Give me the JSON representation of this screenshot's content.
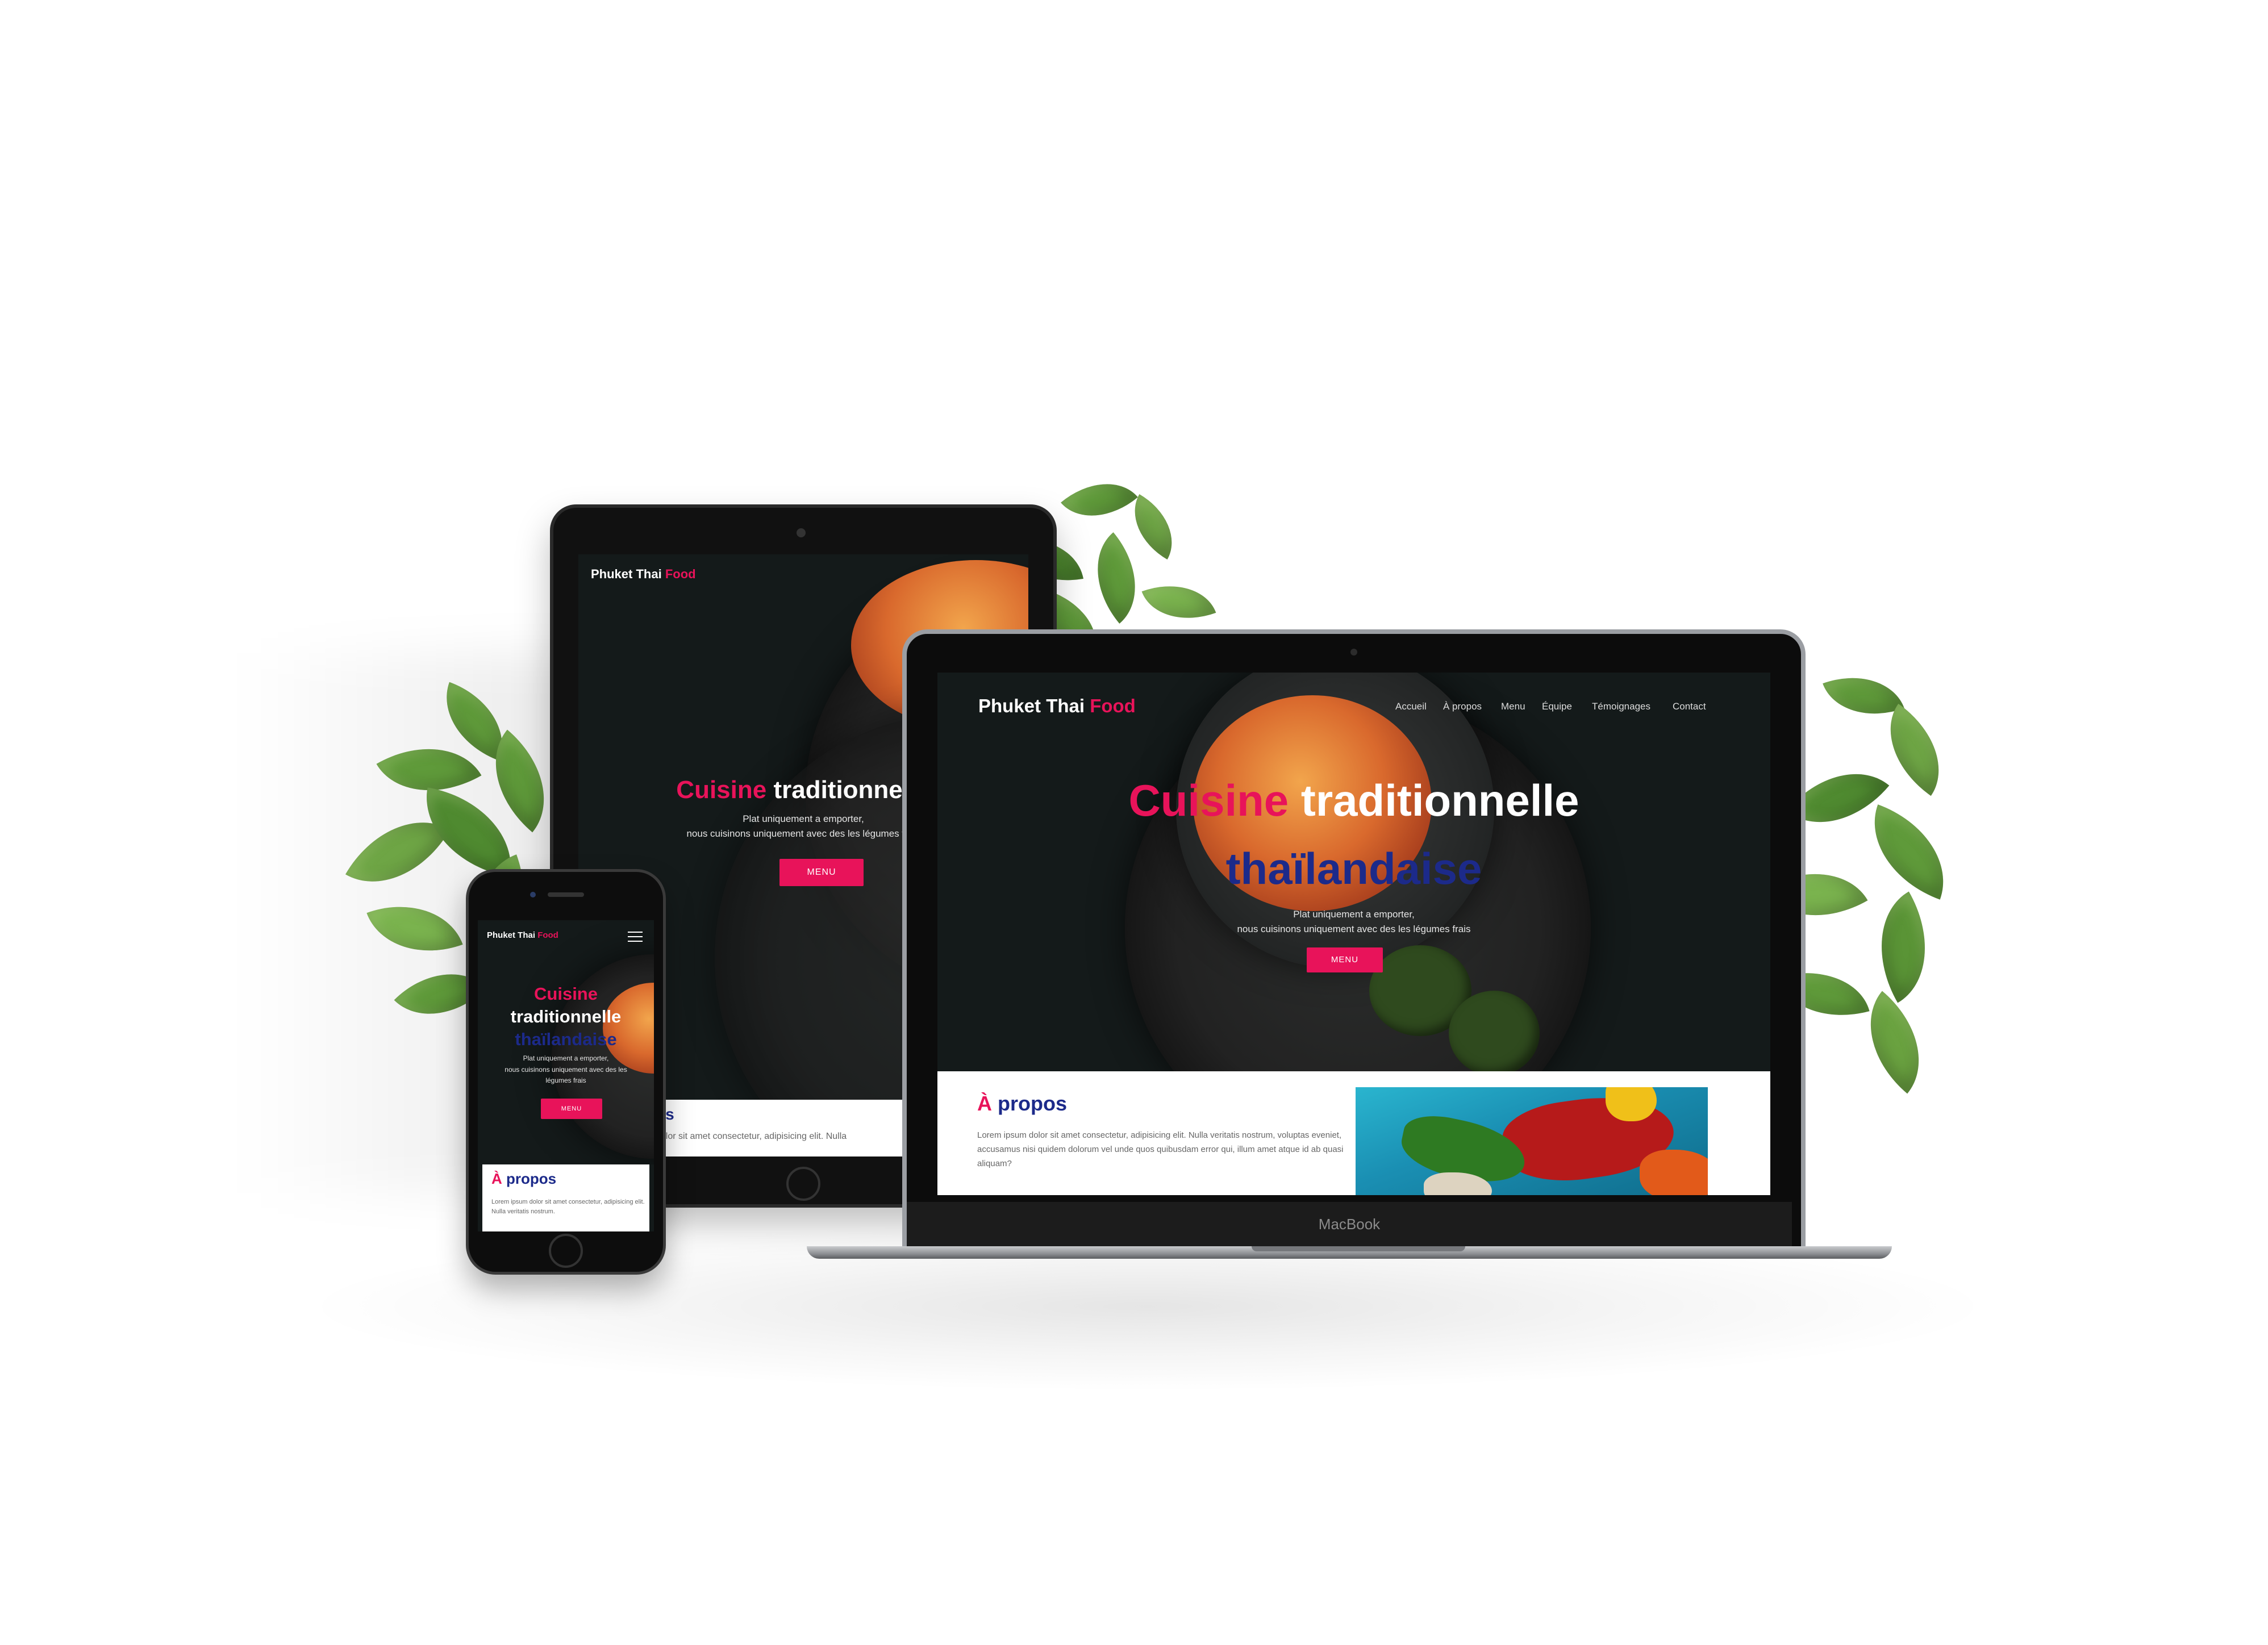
{
  "site": {
    "brand_main": "Phuket Thai",
    "brand_accent": "Food",
    "nav": [
      "Accueil",
      "À propos",
      "Menu",
      "Équipe",
      "Témoignages",
      "Contact"
    ],
    "hero": {
      "title_accent": "Cuisine",
      "title_main": "traditionnelle",
      "title_secondary": "thaïlandaise",
      "subtitle_line1": "Plat uniquement a emporter,",
      "subtitle_line2": "nous cuisinons uniquement avec des les légumes frais",
      "button": "MENU"
    },
    "about": {
      "title_accent": "À",
      "title_main": "propos",
      "text": "Lorem ipsum dolor sit amet consectetur, adipisicing elit. Nulla veritatis nostrum, voluptas eveniet, accusamus nisi quidem dolorum vel unde quos quibusdam error qui, illum amet atque id ab quasi aliquam?"
    }
  },
  "tablet": {
    "hero_subtitle_line1": "Plat uniquement a emporter,",
    "hero_subtitle_line2": "nous cuisinons uniquement avec des les légumes frais",
    "about_fragment_title": "os",
    "about_fragment_text": "dolor sit amet consectetur, adipisicing elit. Nulla"
  },
  "phone": {
    "about_text": "Lorem ipsum dolor sit amet consectetur, adipisicing elit. Nulla veritatis nostrum."
  },
  "laptop": {
    "brand_label": "MacBook"
  },
  "colors": {
    "accent": "#e8135a",
    "secondary": "#1c2a8a",
    "hero_bg": "#141a1a"
  }
}
